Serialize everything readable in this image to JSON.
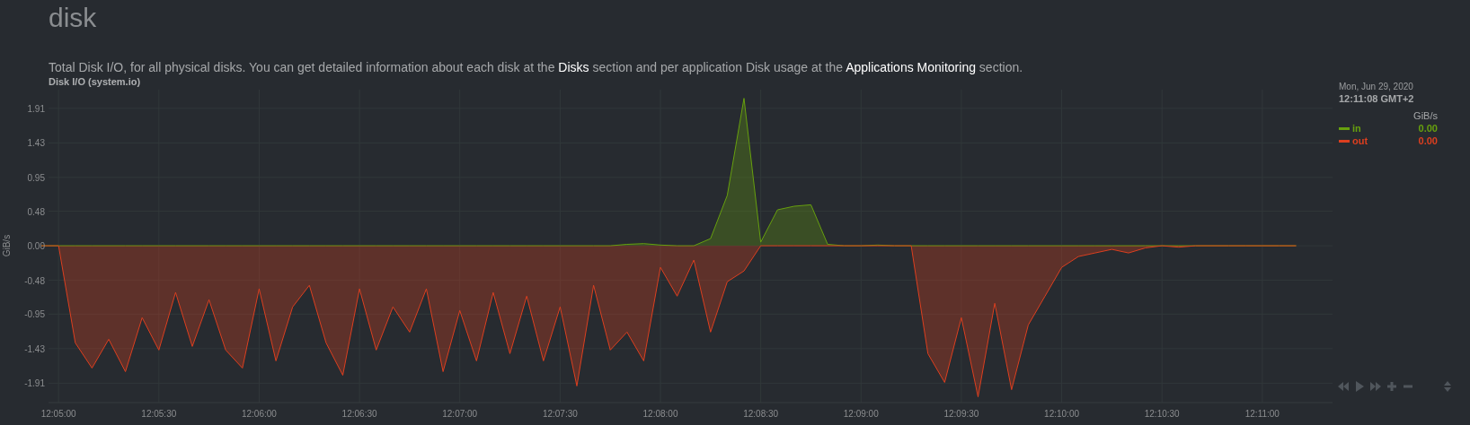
{
  "section_title": "disk",
  "description": [
    {
      "kind": "text",
      "text": "Total Disk I/O, for all physical disks. You can get detailed information about each disk at the "
    },
    {
      "kind": "link",
      "text": "Disks"
    },
    {
      "kind": "text",
      "text": " section and per application Disk usage at the "
    },
    {
      "kind": "link",
      "text": "Applications Monitoring"
    },
    {
      "kind": "text",
      "text": " section."
    }
  ],
  "chart": {
    "title": "Disk I/O (system.io)",
    "chart_data": {
      "type": "area",
      "grid": true,
      "ylabel": "GiB/s",
      "ylim": [
        -2.18,
        2.17
      ],
      "categories": [
        null,
        "12:05:00",
        null,
        null,
        null,
        null,
        null,
        "12:05:30",
        null,
        null,
        null,
        null,
        null,
        "12:06:00",
        null,
        null,
        null,
        null,
        null,
        "12:06:30",
        null,
        null,
        null,
        null,
        null,
        "12:07:00",
        null,
        null,
        null,
        null,
        null,
        "12:07:30",
        null,
        null,
        null,
        null,
        null,
        "12:08:00",
        null,
        null,
        null,
        null,
        null,
        "12:08:30",
        null,
        null,
        null,
        null,
        null,
        "12:09:00",
        null,
        null,
        null,
        null,
        null,
        "12:09:30",
        null,
        null,
        null,
        null,
        null,
        "12:10:00",
        null,
        null,
        null,
        null,
        null,
        "12:10:30",
        null,
        null,
        null,
        null,
        null,
        "12:11:00",
        null,
        null
      ],
      "series": [
        {
          "name": "in",
          "color": "#67a00e",
          "values": [
            0,
            0,
            0,
            0,
            0,
            0,
            0,
            0,
            0,
            0,
            0,
            0,
            0,
            0,
            0,
            0,
            0,
            0,
            0,
            0,
            0,
            0,
            0,
            0,
            0,
            0,
            0,
            0,
            0,
            0,
            0,
            0,
            0,
            0,
            0,
            0.02,
            0.03,
            0.01,
            0,
            0,
            0.1,
            0.7,
            2.05,
            0.05,
            0.5,
            0.55,
            0.57,
            0.02,
            0,
            0,
            0.01,
            0,
            0,
            0,
            0,
            0,
            0,
            0,
            0,
            0,
            0,
            0,
            0,
            0,
            0,
            0,
            0,
            0,
            0,
            0,
            0,
            0,
            0,
            0,
            0,
            0
          ]
        },
        {
          "name": "out",
          "color": "#dd3f1f",
          "values": [
            0,
            0,
            -1.35,
            -1.7,
            -1.3,
            -1.75,
            -1.0,
            -1.45,
            -0.65,
            -1.4,
            -0.75,
            -1.45,
            -1.7,
            -0.6,
            -1.6,
            -0.85,
            -0.55,
            -1.35,
            -1.8,
            -0.6,
            -1.45,
            -0.85,
            -1.2,
            -0.6,
            -1.75,
            -0.9,
            -1.6,
            -0.65,
            -1.5,
            -0.7,
            -1.6,
            -0.85,
            -1.95,
            -0.55,
            -1.45,
            -1.2,
            -1.6,
            -0.3,
            -0.7,
            -0.2,
            -1.2,
            -0.5,
            -0.35,
            0,
            0,
            0,
            0,
            0,
            0,
            0,
            0,
            0,
            0,
            -1.5,
            -1.9,
            -1.0,
            -2.1,
            -0.8,
            -2.0,
            -1.1,
            -0.7,
            -0.3,
            -0.15,
            -0.1,
            -0.05,
            -0.1,
            -0.03,
            0,
            -0.02,
            0,
            0,
            0,
            0,
            0,
            0,
            0
          ]
        }
      ],
      "yticks": [
        {
          "value": 1.91,
          "label": "1.91"
        },
        {
          "value": 1.43,
          "label": "1.43"
        },
        {
          "value": 0.95,
          "label": "0.95"
        },
        {
          "value": 0.48,
          "label": "0.48"
        },
        {
          "value": 0,
          "label": "0.00"
        },
        {
          "value": -0.48,
          "label": "-0.48"
        },
        {
          "value": -0.95,
          "label": "-0.95"
        },
        {
          "value": -1.43,
          "label": "-1.43"
        },
        {
          "value": -1.91,
          "label": "-1.91"
        }
      ]
    }
  },
  "legend": {
    "date": "Mon, Jun 29, 2020",
    "time": "12:11:08 GMT+2",
    "units": "GiB/s",
    "values": [
      "0.00",
      "0.00"
    ]
  }
}
